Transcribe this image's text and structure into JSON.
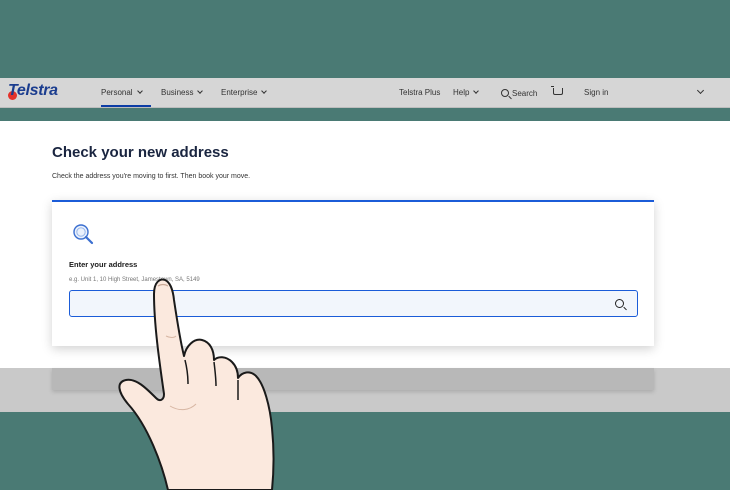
{
  "brand": {
    "logo_text": "Telstra"
  },
  "nav": {
    "personal": "Personal",
    "business": "Business",
    "enterprise": "Enterprise",
    "telstra_plus": "Telstra Plus",
    "help": "Help",
    "search": "Search",
    "sign_in": "Sign in"
  },
  "page": {
    "title": "Check your new address",
    "subtitle": "Check the address you're moving to first. Then book your move."
  },
  "address_form": {
    "label": "Enter your address",
    "hint": "e.g. Unit 1, 10 High Street, Jamestown, SA, 5149",
    "value": ""
  },
  "icons": {
    "logo_mark": "telstra-logo-icon",
    "search": "search-icon",
    "cart": "cart-icon",
    "magnifier": "magnifier-icon",
    "hand": "pointing-hand"
  },
  "colors": {
    "accent": "#1b5cd8",
    "brand_blue": "#1b3d8f",
    "brand_red": "#e4322b",
    "backdrop": "#4a7a74"
  }
}
